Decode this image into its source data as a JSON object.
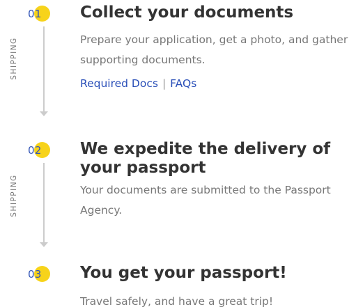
{
  "colors": {
    "accent_yellow": "#f7d31a",
    "link_blue": "#2a4fb8",
    "step_number_blue": "#3557b7",
    "title_text": "#333333",
    "body_text": "#777777",
    "rail_gray": "#cccccc"
  },
  "steps": [
    {
      "number": "01",
      "side_label": "SHIPPING",
      "title": "Collect your documents",
      "description": "Prepare your application, get a photo, and gather supporting documents.",
      "links": [
        {
          "label": "Required Docs"
        },
        {
          "label": "FAQs"
        }
      ],
      "link_separator": "|"
    },
    {
      "number": "02",
      "side_label": "SHIPPING",
      "title": "We expedite the delivery of your passport",
      "description": "Your documents are submitted to the Passport Agency."
    },
    {
      "number": "03",
      "title": "You get your passport!",
      "description": "Travel safely, and have a great trip!"
    }
  ]
}
